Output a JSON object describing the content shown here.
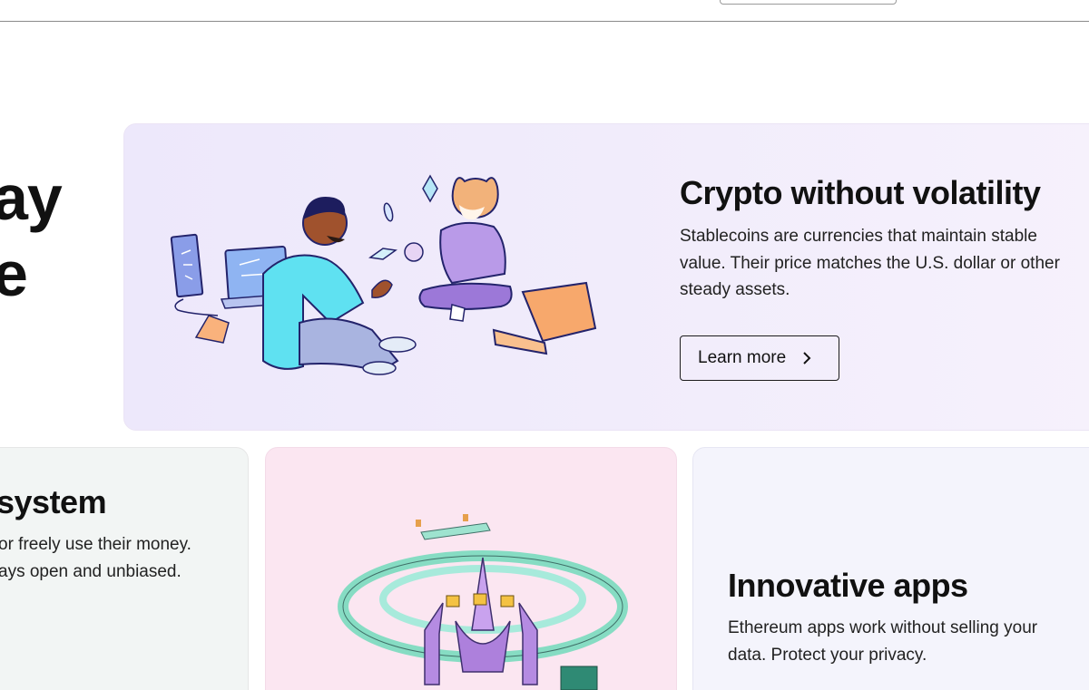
{
  "hero": {
    "line1": "ay",
    "line2": "e"
  },
  "feature": {
    "title": "Crypto without volatility",
    "description": "Stablecoins are currencies that maintain stable value. Their price matches the U.S. dollar or other steady assets.",
    "button_label": "Learn more",
    "button_icon": "chevron-right-icon",
    "background": "#efe9fb"
  },
  "system_card": {
    "title": "system",
    "line1": "or freely use their money.",
    "line2": "ays open and unbiased.",
    "background": "#f2f5f4"
  },
  "nft_card": {
    "background": "#fbe6f1"
  },
  "apps_card": {
    "title": "Innovative apps",
    "description": "Ethereum apps work without selling your data. Protect your privacy.",
    "background": "#f4f4fc"
  }
}
